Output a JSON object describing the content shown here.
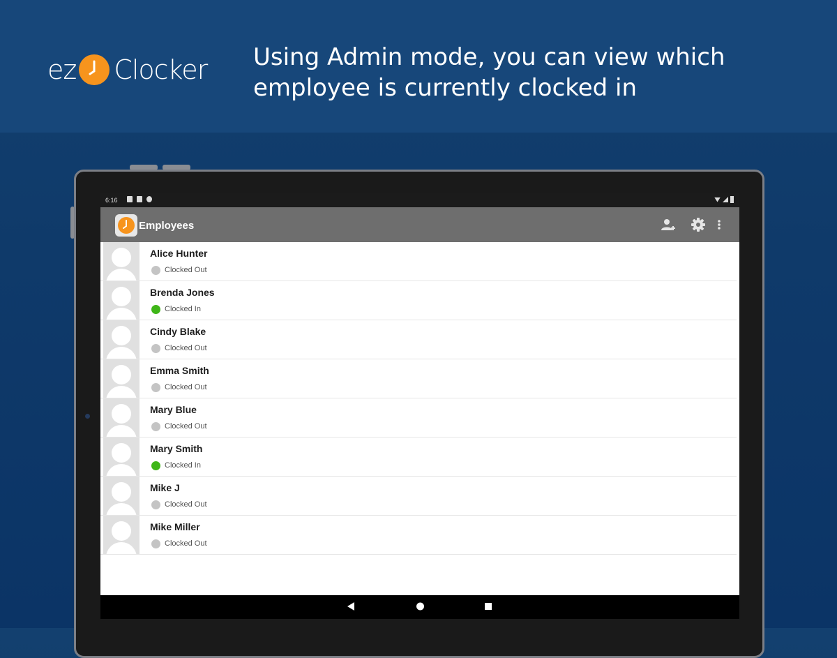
{
  "promo": {
    "logo_left": "ez",
    "logo_right": "Clocker",
    "headline_line1": "Using Admin mode, you can view which",
    "headline_line2": "employee is currently clocked in"
  },
  "status_bar": {
    "time": "6:16"
  },
  "app_bar": {
    "title": "Employees",
    "actions": [
      "add-person-icon",
      "gear-icon",
      "more-vert-icon"
    ]
  },
  "employees": [
    {
      "name": "Alice Hunter",
      "status": "Clocked Out",
      "status_color": "#c4c4c4"
    },
    {
      "name": "Brenda Jones",
      "status": "Clocked In",
      "status_color": "#3fb618"
    },
    {
      "name": "Cindy Blake",
      "status": "Clocked Out",
      "status_color": "#c4c4c4"
    },
    {
      "name": "Emma Smith",
      "status": "Clocked Out",
      "status_color": "#c4c4c4"
    },
    {
      "name": "Mary Blue",
      "status": "Clocked Out",
      "status_color": "#c4c4c4"
    },
    {
      "name": "Mary Smith",
      "status": "Clocked In",
      "status_color": "#3fb618"
    },
    {
      "name": "Mike J",
      "status": "Clocked Out",
      "status_color": "#c4c4c4"
    },
    {
      "name": "Mike Miller",
      "status": "Clocked Out",
      "status_color": "#c4c4c4"
    }
  ],
  "nav_bar": [
    "back-icon",
    "home-icon",
    "recents-icon"
  ],
  "colors": {
    "brand_orange": "#f7941d",
    "background_blue": "#17477a",
    "app_bar_gray": "#6e6e6e"
  }
}
